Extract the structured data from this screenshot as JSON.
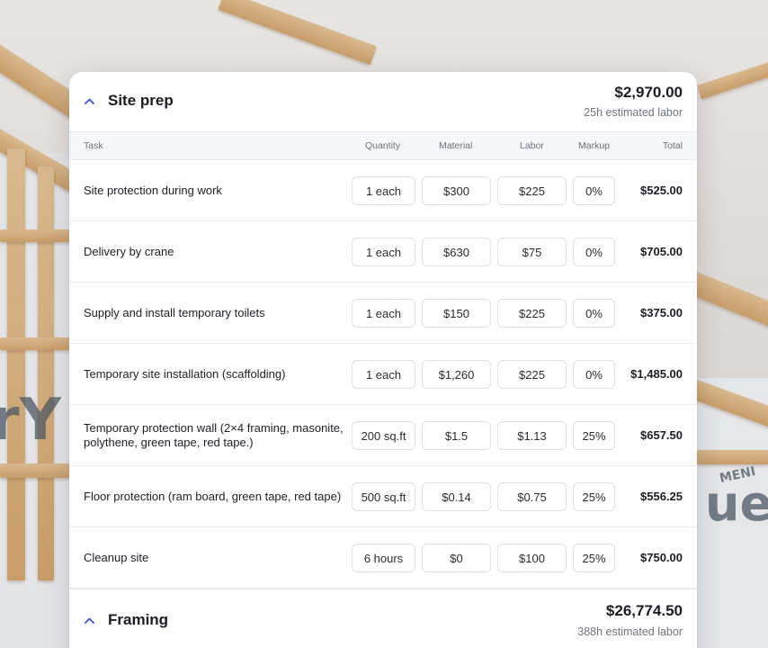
{
  "sections": [
    {
      "title": "Site prep",
      "total": "$2,970.00",
      "labor": "25h estimated labor",
      "expanded": true
    },
    {
      "title": "Framing",
      "total": "$26,774.50",
      "labor": "388h estimated labor",
      "expanded": true
    }
  ],
  "table": {
    "headers": {
      "task": "Task",
      "quantity": "Quantity",
      "material": "Material",
      "labor": "Labor",
      "markup": "Markup",
      "total": "Total"
    },
    "rows": [
      {
        "task": "Site protection during work",
        "quantity": "1 each",
        "material": "$300",
        "labor": "$225",
        "markup": "0%",
        "total": "$525.00"
      },
      {
        "task": "Delivery by crane",
        "quantity": "1 each",
        "material": "$630",
        "labor": "$75",
        "markup": "0%",
        "total": "$705.00"
      },
      {
        "task": "Supply and install temporary toilets",
        "quantity": "1 each",
        "material": "$150",
        "labor": "$225",
        "markup": "0%",
        "total": "$375.00"
      },
      {
        "task": "Temporary site installation (scaffolding)",
        "quantity": "1 each",
        "material": "$1,260",
        "labor": "$225",
        "markup": "0%",
        "total": "$1,485.00"
      },
      {
        "task": "Temporary protection wall (2×4 framing, masonite, polythene, green tape, red tape.)",
        "quantity": "200 sq.ft",
        "material": "$1.5",
        "labor": "$1.13",
        "markup": "25%",
        "total": "$657.50"
      },
      {
        "task": "Floor protection (ram board, green tape, red tape)",
        "quantity": "500 sq.ft",
        "material": "$0.14",
        "labor": "$0.75",
        "markup": "25%",
        "total": "$556.25"
      },
      {
        "task": "Cleanup site",
        "quantity": "6 hours",
        "material": "$0",
        "labor": "$100",
        "markup": "25%",
        "total": "$750.00"
      }
    ]
  },
  "background": {
    "wrap_text_left": "rY",
    "wrap_text_right": "ue",
    "wrap_text_right_small": "MENI"
  },
  "colors": {
    "accent": "#3b50d6",
    "card_bg": "#ffffff",
    "header_bg": "#f6f7fb"
  },
  "icons": {
    "collapse": "chevron-up-icon"
  }
}
